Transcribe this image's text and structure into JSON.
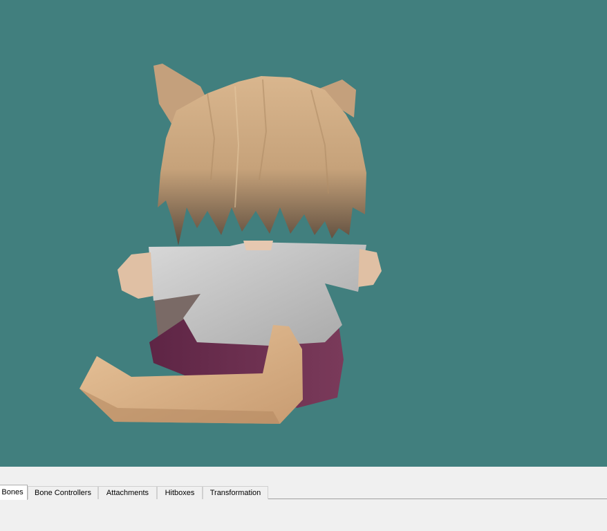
{
  "viewport": {
    "background": "#417f7e",
    "model": "character-back-view"
  },
  "tabs": [
    {
      "label": "Bones",
      "active": true
    },
    {
      "label": "Bone Controllers",
      "active": false
    },
    {
      "label": "Attachments",
      "active": false
    },
    {
      "label": "Hitboxes",
      "active": false
    },
    {
      "label": "Transformation",
      "active": false
    }
  ]
}
